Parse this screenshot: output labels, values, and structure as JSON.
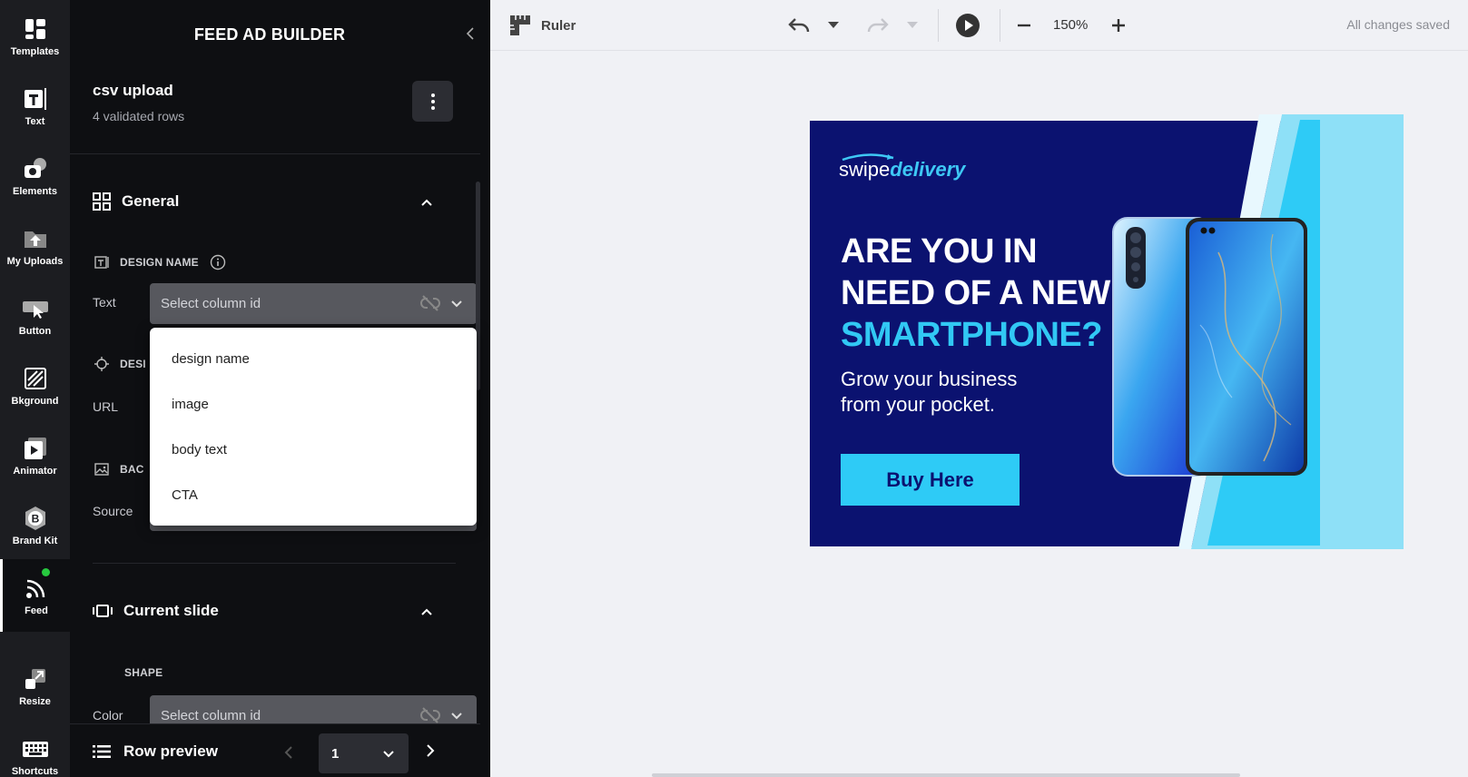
{
  "rail": {
    "items": [
      {
        "label": "Templates",
        "icon": "templates-icon"
      },
      {
        "label": "Text",
        "icon": "text-icon"
      },
      {
        "label": "Elements",
        "icon": "elements-icon"
      },
      {
        "label": "My Uploads",
        "icon": "uploads-icon"
      },
      {
        "label": "Button",
        "icon": "button-icon"
      },
      {
        "label": "Bkground",
        "icon": "background-icon"
      },
      {
        "label": "Animator",
        "icon": "animator-icon"
      },
      {
        "label": "Brand Kit",
        "icon": "brand-kit-icon"
      },
      {
        "label": "Feed",
        "icon": "feed-icon",
        "active": true
      },
      {
        "label": "Resize",
        "icon": "resize-icon"
      },
      {
        "label": "Shortcuts",
        "icon": "keyboard-icon"
      }
    ]
  },
  "panel": {
    "title": "FEED AD BUILDER",
    "csv": {
      "title": "csv upload",
      "subtitle": "4 validated rows"
    },
    "general": {
      "title": "General",
      "design_name": {
        "heading": "DESIGN NAME",
        "label": "Text",
        "placeholder": "Select column id"
      },
      "design_url": {
        "heading_partial": "DESI",
        "label": "URL"
      },
      "background": {
        "heading_partial": "BAC",
        "label": "Source"
      }
    },
    "dropdown_options": [
      "design name",
      "image",
      "body text",
      "CTA"
    ],
    "current_slide": {
      "title": "Current slide",
      "shape_heading": "SHAPE",
      "color_label": "Color",
      "color_placeholder": "Select column id"
    },
    "row_preview": {
      "title": "Row preview",
      "value": "1"
    }
  },
  "toolbar": {
    "ruler_label": "Ruler",
    "zoom": "150%",
    "status": "All changes saved"
  },
  "ad": {
    "brand_a": "swipe",
    "brand_b": "delivery",
    "headline_1": "ARE YOU IN",
    "headline_2": "NEED OF A NEW",
    "headline_3": "SMARTPHONE?",
    "subline_1": "Grow your business",
    "subline_2": "from your pocket.",
    "cta": "Buy Here",
    "colors": {
      "navy": "#0b1270",
      "cyan": "#2ecbf6",
      "light_cyan": "#8ee0f7"
    }
  }
}
